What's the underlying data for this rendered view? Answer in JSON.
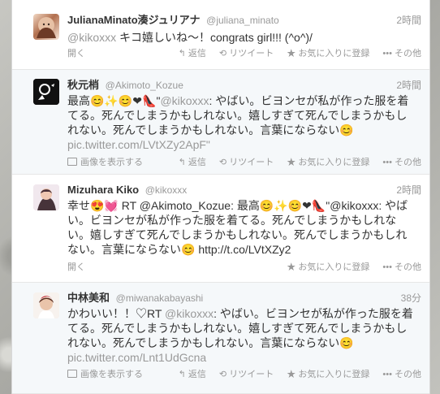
{
  "tweets": [
    {
      "name": "JulianaMinato湊ジュリアナ",
      "handle": "@juliana_minato",
      "time": "2時間",
      "mention": "@kikoxxx",
      "text": " キコ嬉しいね〜！congrats girl!!! (^o^)/",
      "link": "",
      "footer_left": "開く",
      "reply": "↰ 返信",
      "retweet": "⟲ リツイート",
      "favorite": "★ お気に入りに登録",
      "more": "••• その他"
    },
    {
      "name": "秋元梢",
      "handle": "@Akimoto_Kozue",
      "time": "2時間",
      "mention": "@kikoxxx",
      "text_prefix": "最高😊✨😊❤👠\"",
      "text": ": やばい。ビヨンセが私が作った服を着てる。死んでしまうかもしれない。嬉しすぎて死んでしまうかもしれない。死んでしまうかもしれない。言葉にならない😊",
      "link": "pic.twitter.com/LVtXZy2ApF\"",
      "footer_left": "画像を表示する",
      "reply": "↰ 返信",
      "retweet": "⟲ リツイート",
      "favorite": "★ お気に入りに登録",
      "more": "••• その他"
    },
    {
      "name": "Mizuhara Kiko",
      "handle": "@kikoxxx",
      "time": "2時間",
      "text": "幸せ😍💓 RT @Akimoto_Kozue: 最高😊✨😊❤👠\"@kikoxxx: やばい。ビヨンセが私が作った服を着てる。死んでしまうかもしれない。嬉しすぎて死んでしまうかもしれない。死んでしまうかもしれない。言葉にならない😊 http://t.co/LVtXZy2",
      "footer_left": "開く",
      "reply": "",
      "retweet": "",
      "favorite": "★ お気に入りに登録",
      "more": "••• その他"
    },
    {
      "name": "中林美和",
      "handle": "@miwanakabayashi",
      "time": "38分",
      "text_prefix": "かわいい！！♡RT ",
      "mention": "@kikoxxx",
      "text": ": やばい。ビヨンセが私が作った服を着てる。死んでしまうかもしれない。嬉しすぎて死んでしまうかもしれない。死んでしまうかもしれない。言葉にならない😊",
      "link": "pic.twitter.com/Lnt1UdGcna",
      "footer_left": "画像を表示する",
      "reply": "↰ 返信",
      "retweet": "⟲ リツイート",
      "favorite": "★ お気に入りに登録",
      "more": "••• その他"
    }
  ],
  "colors": {
    "text": "#333333",
    "muted": "#999999",
    "divider": "#e6e6e6"
  }
}
